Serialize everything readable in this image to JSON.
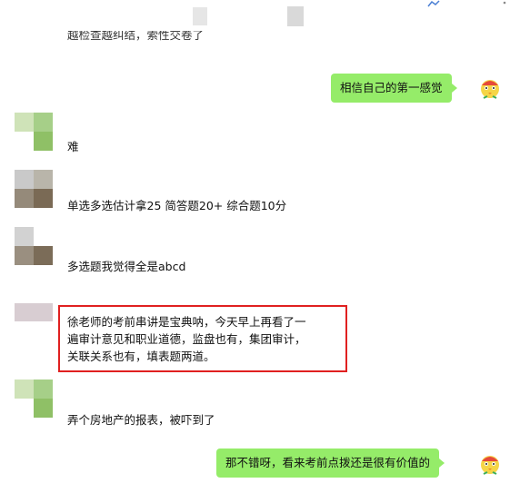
{
  "top_icons": [
    "share-icon",
    "more-icon"
  ],
  "messages": {
    "m0_clipped": "越检查越纠结，索性交卷了",
    "m1_right": "相信自己的第一感觉",
    "m2": "难",
    "m3": "单选多选估计拿25 简答题20+ 综合题10分",
    "m4": "多选题我觉得全是abcd",
    "m5_lines": [
      "徐老师的考前串讲是宝典呐，今天早上再看了一",
      "遍审计意见和职业道德，监盘也有，集团审计，",
      "关联关系也有，填表题两道。"
    ],
    "m6": "弄个房地产的报表，被吓到了",
    "m7_right": "那不错呀，看来考前点拨还是很有价值的"
  },
  "colors": {
    "bubble_green": "#95ec69",
    "highlight_red": "#e02020"
  }
}
